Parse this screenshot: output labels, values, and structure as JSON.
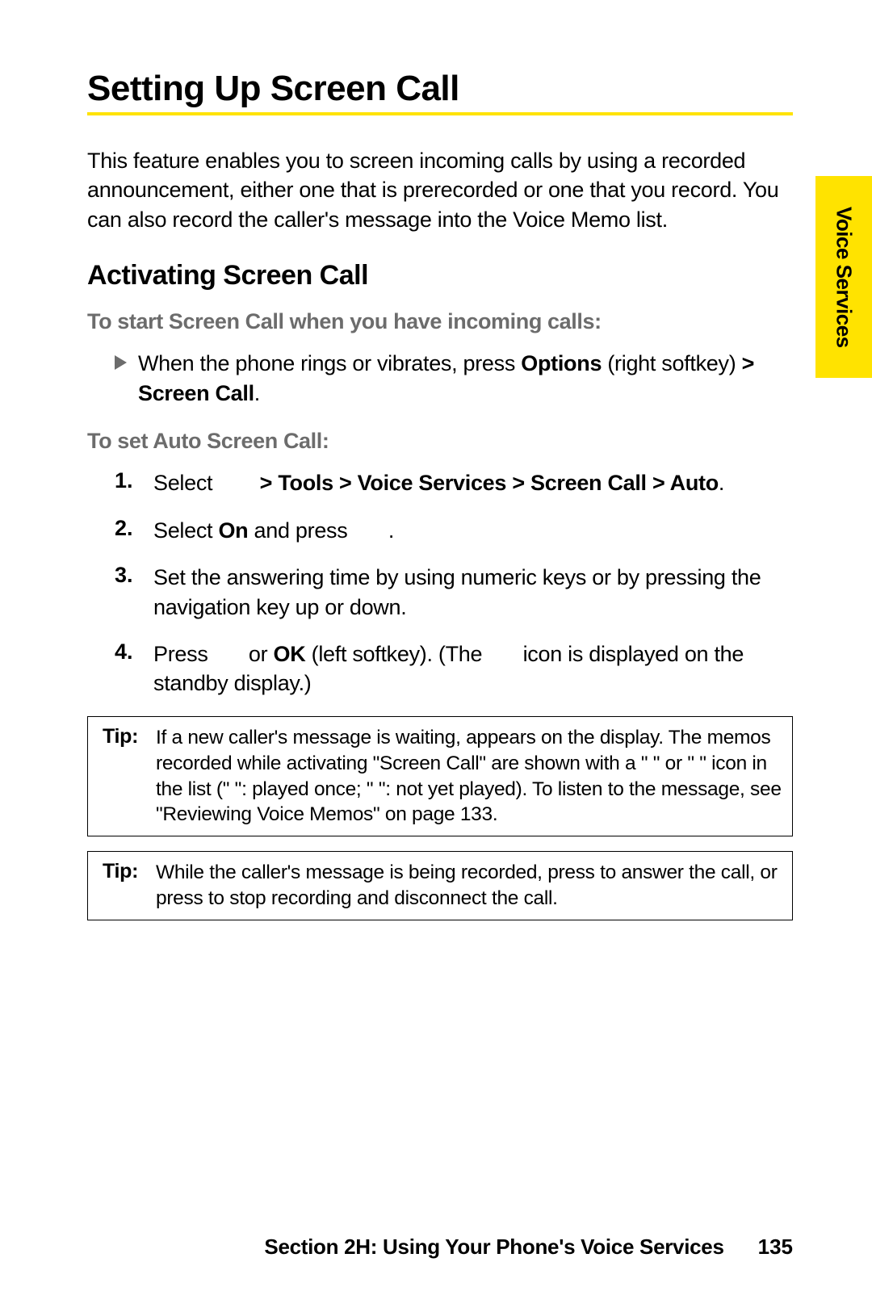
{
  "sideTab": "Voice Services",
  "heading": "Setting Up Screen Call",
  "intro": "This feature enables you to screen incoming calls by using a recorded announcement, either one that is prerecorded or one that you record. You can also record the caller's message into the Voice Memo list.",
  "subHeading": "Activating Screen Call",
  "lead1": "To start Screen Call when you have incoming calls:",
  "bullet1_a": "When the phone rings or vibrates, press ",
  "bullet1_b": "Options",
  "bullet1_c": " (right softkey) ",
  "bullet1_d": "> Screen Call",
  "bullet1_e": ".",
  "lead2": "To set Auto Screen Call:",
  "step1_num": "1.",
  "step1_a": "Select ",
  "step1_b": " > Tools > Voice Services > Screen Call > Auto",
  "step1_c": ".",
  "step2_num": "2.",
  "step2_a": "Select ",
  "step2_b": "On",
  "step2_c": " and press ",
  "step2_d": " .",
  "step3_num": "3.",
  "step3": "Set the answering time by using numeric keys or by pressing the navigation key up or down.",
  "step4_num": "4.",
  "step4_a": "Press ",
  "step4_b": " or ",
  "step4_c": "OK",
  "step4_d": " (left softkey). (The ",
  "step4_e": " icon is displayed on the standby display.)",
  "tipLabel": "Tip:",
  "tip1": "If a new caller's message is waiting,        appears on the display. The memos recorded while activating \"Screen Call\" are shown with a \"     \" or \"     \" icon in the list (\"     \": played once; \"     \": not yet played). To listen to the message, see \"Reviewing Voice Memos\" on page 133.",
  "tip2": "While the caller's message is being recorded, press         to answer the call, or press         to stop recording and disconnect the call.",
  "footerSection": "Section 2H: Using Your Phone's Voice Services",
  "pageNumber": "135"
}
